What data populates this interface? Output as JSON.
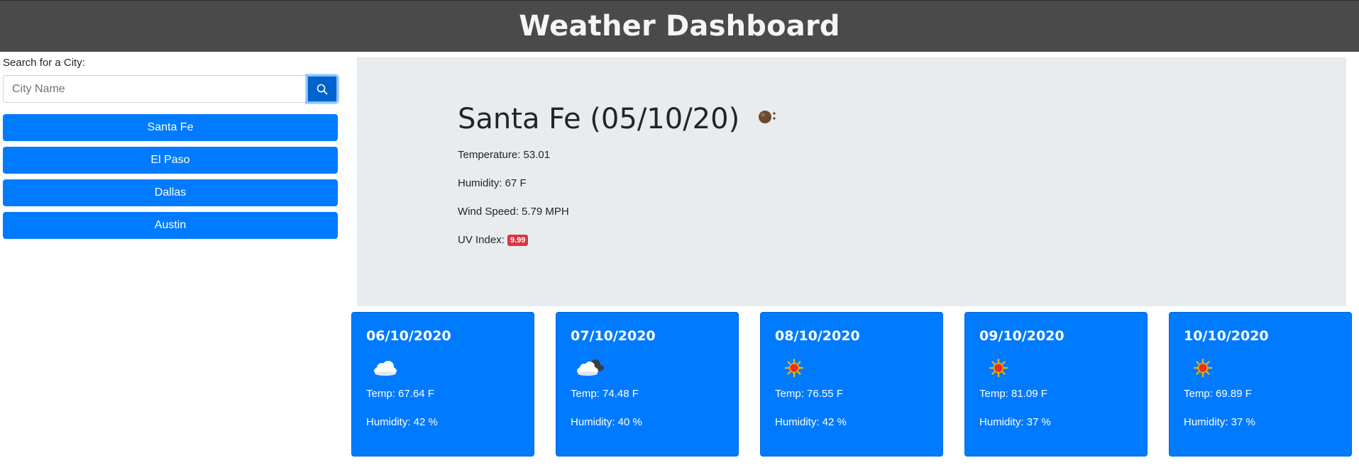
{
  "header": {
    "title": "Weather Dashboard"
  },
  "search": {
    "label": "Search for a City:",
    "placeholder": "City Name",
    "value": ""
  },
  "history": [
    {
      "label": "Santa Fe"
    },
    {
      "label": "El Paso"
    },
    {
      "label": "Dallas"
    },
    {
      "label": "Austin"
    }
  ],
  "current": {
    "title": "Santa Fe (05/10/20)",
    "icon": "fog-icon",
    "temperature": "Temperature: 53.01",
    "humidity": "Humidity: 67 F",
    "wind": "Wind Speed: 5.79 MPH",
    "uv_label": "UV Index:",
    "uv_value": "9.99"
  },
  "forecast": [
    {
      "date": "06/10/2020",
      "icon": "cloud-icon",
      "temp": "Temp: 67.64 F",
      "humidity": "Humidity: 42 %"
    },
    {
      "date": "07/10/2020",
      "icon": "dark-cloud-icon",
      "temp": "Temp: 74.48 F",
      "humidity": "Humidity: 40 %"
    },
    {
      "date": "08/10/2020",
      "icon": "sun-icon",
      "temp": "Temp: 76.55 F",
      "humidity": "Humidity: 42 %"
    },
    {
      "date": "09/10/2020",
      "icon": "sun-icon",
      "temp": "Temp: 81.09 F",
      "humidity": "Humidity: 37 %"
    },
    {
      "date": "10/10/2020",
      "icon": "sun-icon",
      "temp": "Temp: 69.89 F",
      "humidity": "Humidity: 37 %"
    }
  ],
  "colors": {
    "header_bg": "#4a4a4a",
    "primary": "#007bff",
    "panel_bg": "#e9ecef",
    "uv_badge": "#dc3545"
  }
}
